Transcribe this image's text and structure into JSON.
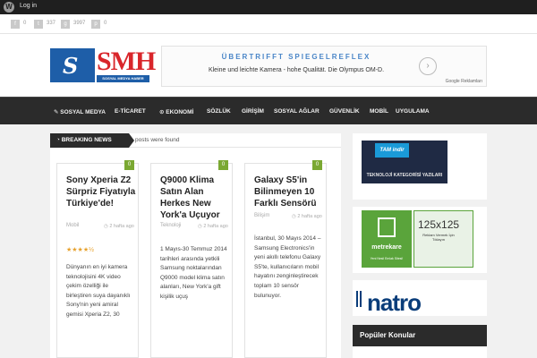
{
  "admin_bar": {
    "login_label": "Log in"
  },
  "share_bar": {
    "items": [
      {
        "icon": "facebook-icon",
        "count": "0"
      },
      {
        "icon": "twitter-icon",
        "count": "337"
      },
      {
        "icon": "google-plus-icon",
        "count": "3997"
      },
      {
        "icon": "pinterest-icon",
        "count": "0"
      }
    ]
  },
  "logo": {
    "text": "SMH",
    "subtitle": "SOSYAL MEDYA HABER"
  },
  "ad": {
    "headline": "ÜBERTRIFFT SPIEGELREFLEX",
    "body": "Kleine und leichte Kamera - hohe Qualität. Die Olympus OM-D.",
    "footer": "Google Reklamları"
  },
  "nav": {
    "items": [
      "SOSYAL MEDYA",
      "E-TİCARET",
      "EKONOMİ",
      "SÖZLÜK",
      "GİRİŞİM",
      "SOSYAL AĞLAR",
      "GÜVENLİK",
      "MOBİL",
      "UYGULAMA"
    ]
  },
  "breaking": {
    "label": "BREAKING NEWS",
    "text": "posts were found"
  },
  "posts": [
    {
      "badge": "0",
      "title": "Sony Xperia Z2 Sürpriz Fiyatıyla Türkiye'de!",
      "category": "Mobil",
      "date": "2 hafta ago",
      "rating": 4.5,
      "stars": "★★★★½",
      "excerpt": "Dünyanın en iyi kamera teknolojisini 4K video çekim özelliği ile birleştiren suya dayanıklı Sony'nin yeni amiral gemisi Xperia Z2, 30"
    },
    {
      "badge": "0",
      "title": "Q9000 Klima Satın Alan Herkes New York'a Uçuyor",
      "category": "Teknoloji",
      "date": "2 hafta ago",
      "excerpt": "1 Mayıs-30 Temmuz 2014 tarihleri arasında yetkili Samsung noktalarından Q9000 model klima satın alanları, New York'a gift kişilik uçuş"
    },
    {
      "badge": "0",
      "title": "Galaxy S5'in Bilinmeyen 10 Farklı Sensörü",
      "category": "Bilişim",
      "date": "2 hafta ago",
      "excerpt": "İstanbul, 30 Mayıs 2014 – Samsung Electronics'in yeni akıllı telefonu Galaxy S5'te, kullanıcıların mobil hayatını zenginleştirecek toplam 10 sensör bulunuyor."
    }
  ],
  "sidebar": {
    "tamindir_logo": "TAM indir",
    "tamindir_caption": "TEKNOLOJİ KATEGORİSİ YAZILARI",
    "metrekare_name": "metrekare",
    "metrekare_tag": "Yeni Nesil Emlak Sitesi!",
    "metrekare_size": "125x125",
    "metrekare_sub": "Reklam Vermek İçin Tıklayın",
    "natro_text": "natro",
    "popular_title": "Popüler Konular"
  },
  "colors": {
    "accent_green": "#7aa832",
    "nav_bg": "#2b2b2b",
    "logo_red": "#d9262b",
    "logo_blue": "#1e5ea8"
  }
}
